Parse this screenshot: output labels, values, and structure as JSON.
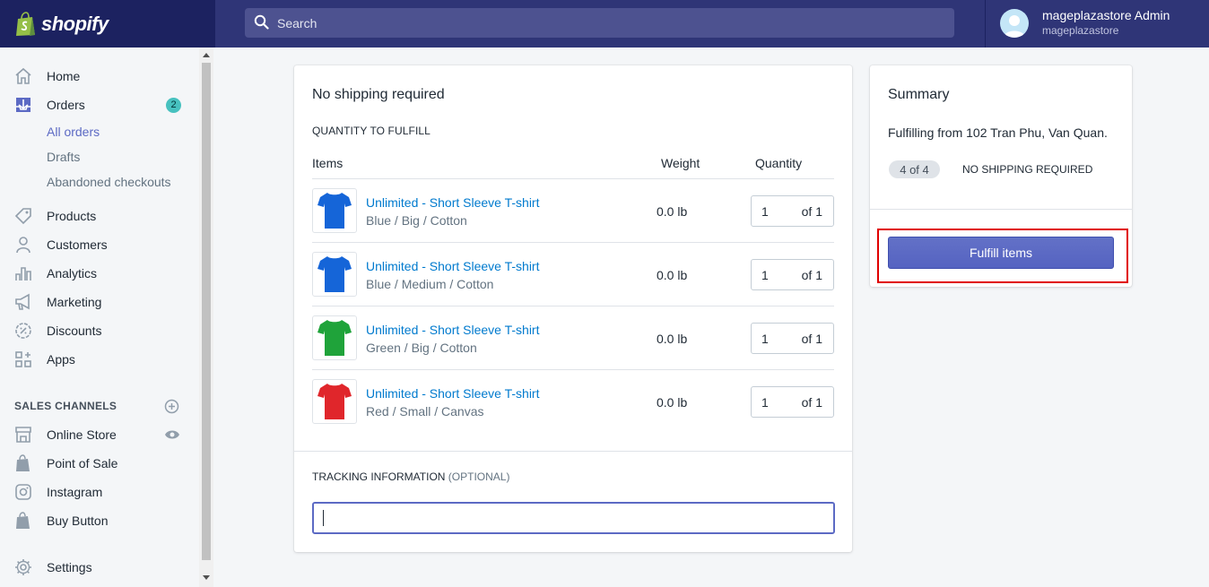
{
  "brand": {
    "name": "shopify",
    "icon": "shopify-bag-icon"
  },
  "search": {
    "placeholder": "Search"
  },
  "user": {
    "name": "mageplazastore Admin",
    "shop": "mageplazastore"
  },
  "sidebar": {
    "items": [
      {
        "label": "Home",
        "icon": "home-icon"
      },
      {
        "label": "Orders",
        "icon": "orders-icon",
        "badge": "2"
      },
      {
        "label": "Products",
        "icon": "tag-icon"
      },
      {
        "label": "Customers",
        "icon": "person-icon"
      },
      {
        "label": "Analytics",
        "icon": "bar-chart-icon"
      },
      {
        "label": "Marketing",
        "icon": "megaphone-icon"
      },
      {
        "label": "Discounts",
        "icon": "discount-icon"
      },
      {
        "label": "Apps",
        "icon": "apps-icon"
      }
    ],
    "orders_sub": [
      "All orders",
      "Drafts",
      "Abandoned checkouts"
    ],
    "sales_channels_title": "SALES CHANNELS",
    "channels": [
      {
        "label": "Online Store",
        "icon": "store-icon"
      },
      {
        "label": "Point of Sale",
        "icon": "shopify-bag-icon"
      },
      {
        "label": "Instagram",
        "icon": "instagram-icon"
      },
      {
        "label": "Buy Button",
        "icon": "shopify-bag-icon"
      }
    ],
    "settings": "Settings"
  },
  "fulfillment": {
    "title": "No shipping required",
    "quantity_heading": "QUANTITY TO FULFILL",
    "columns": {
      "items": "Items",
      "weight": "Weight",
      "quantity": "Quantity"
    },
    "rows": [
      {
        "name": "Unlimited - Short Sleeve T-shirt",
        "variant": "Blue / Big / Cotton",
        "weight": "0.0 lb",
        "qty": "1",
        "of": "of 1",
        "color": "#1565d8"
      },
      {
        "name": "Unlimited - Short Sleeve T-shirt",
        "variant": "Blue / Medium / Cotton",
        "weight": "0.0 lb",
        "qty": "1",
        "of": "of 1",
        "color": "#1565d8"
      },
      {
        "name": "Unlimited - Short Sleeve T-shirt",
        "variant": "Green / Big / Cotton",
        "weight": "0.0 lb",
        "qty": "1",
        "of": "of 1",
        "color": "#1fa33a"
      },
      {
        "name": "Unlimited - Short Sleeve T-shirt",
        "variant": "Red / Small / Canvas",
        "weight": "0.0 lb",
        "qty": "1",
        "of": "of 1",
        "color": "#e0262b"
      }
    ],
    "tracking_label": "TRACKING INFORMATION",
    "tracking_optional": "(OPTIONAL)",
    "tracking_value": ""
  },
  "summary": {
    "title": "Summary",
    "location": "Fulfilling from 102 Tran Phu, Van Quan.",
    "count": "4 of 4",
    "shipping": "NO SHIPPING REQUIRED",
    "button": "Fulfill items"
  },
  "colors": {
    "primary": "#5c6ac4",
    "topbar": "#1c2260",
    "highlight": "#e00000",
    "link": "#007ace"
  }
}
